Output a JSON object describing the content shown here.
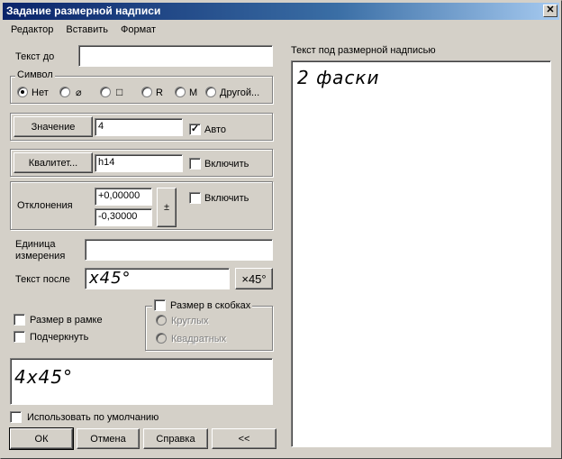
{
  "window": {
    "title": "Задание размерной надписи",
    "close_glyph": "✕"
  },
  "menu": [
    {
      "label": "Редактор"
    },
    {
      "label": "Вставить"
    },
    {
      "label": "Формат"
    }
  ],
  "text_before": {
    "label": "Текст до",
    "value": ""
  },
  "symbol": {
    "title": "Символ",
    "options": [
      "Нет",
      "⌀",
      "□",
      "R",
      "M",
      "Другой..."
    ],
    "selected": "Нет"
  },
  "value_row": {
    "button": "Значение",
    "value": "4",
    "auto_label": "Авто",
    "auto_checked": true
  },
  "qualitet_row": {
    "button": "Квалитет...",
    "value": "h14",
    "include_label": "Включить",
    "include_checked": false
  },
  "deviations": {
    "label": "Отклонения",
    "upper": "+0,00000",
    "lower": "-0,30000",
    "pm_button": "±",
    "include_label": "Включить",
    "include_checked": false
  },
  "unit": {
    "label": "Единица измерения",
    "value": ""
  },
  "text_after": {
    "label": "Текст после",
    "value": "x45°",
    "button": "×45°"
  },
  "options": {
    "in_frame": "Размер в рамке",
    "underline": "Подчеркнуть",
    "in_brackets": "Размер в скобках",
    "round": "Круглых",
    "square": "Квадратных"
  },
  "preview": {
    "value": "4x45°"
  },
  "use_default": "Использовать по умолчанию",
  "buttons": {
    "ok": "ОК",
    "cancel": "Отмена",
    "help": "Справка",
    "collapse": "<<"
  },
  "under_text": {
    "label": "Текст под размерной надписью",
    "value": "2 фаски"
  }
}
